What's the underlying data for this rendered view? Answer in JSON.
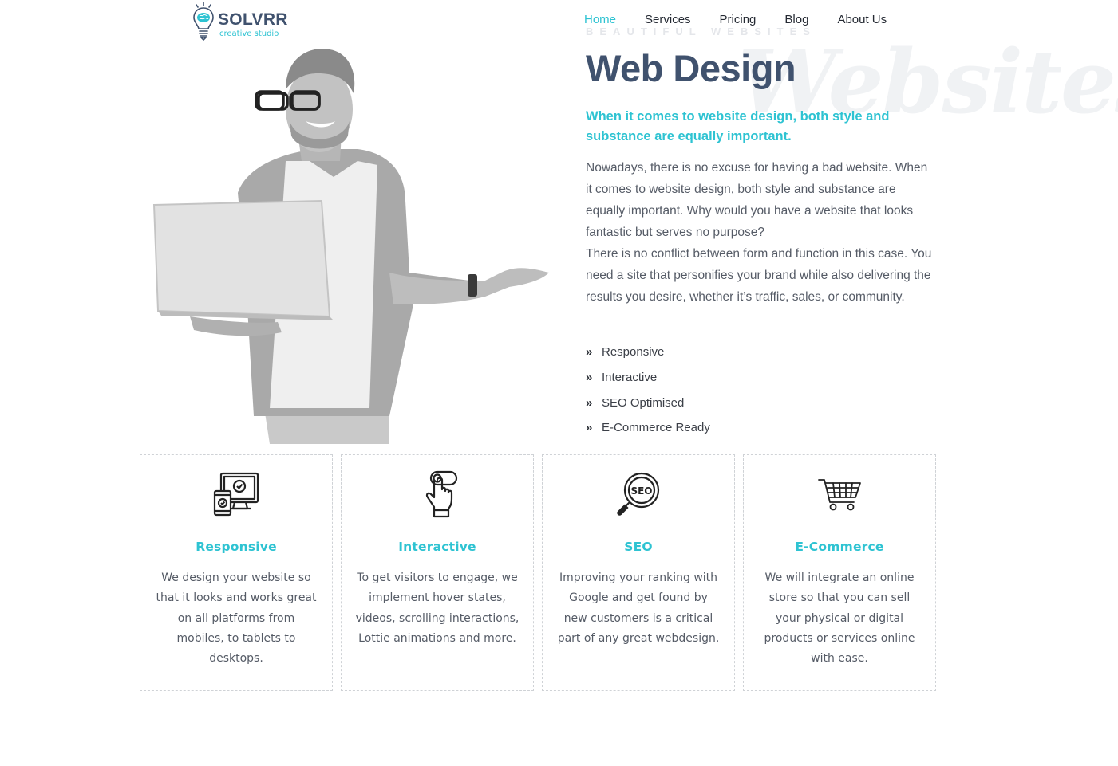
{
  "brand": {
    "name": "SOLVRR",
    "tagline": "creative studio"
  },
  "nav": {
    "items": [
      {
        "label": "Home",
        "active": true
      },
      {
        "label": "Services",
        "active": false
      },
      {
        "label": "Pricing",
        "active": false
      },
      {
        "label": "Blog",
        "active": false
      },
      {
        "label": "About Us",
        "active": false
      }
    ]
  },
  "hero": {
    "overline": "BEAUTIFUL WEBSITES",
    "watermark": "Websites",
    "title": "Web Design",
    "lead": "When it comes to website design, both style and substance are equally important.",
    "paragraphs": [
      "Nowadays, there is no excuse for having a bad website. When it comes to website design, both style and substance are equally important. Why would you have a website that looks fantastic but serves no purpose?",
      "There is no conflict between form and function in this case. You need a site that personifies your brand while also delivering the results you desire, whether it’s traffic, sales, or community."
    ],
    "features": [
      "Responsive",
      "Interactive",
      "SEO Optimised",
      "E-Commerce Ready"
    ],
    "feature_icon": "double-chevron-right-icon"
  },
  "cards": [
    {
      "icon": "devices-icon",
      "title": "Responsive",
      "text": "We design your website so that it looks and works great on all platforms from mobiles, to tablets to desktops."
    },
    {
      "icon": "touch-hand-icon",
      "title": "Interactive",
      "text": "To get visitors to engage, we implement hover states, videos, scrolling interactions, Lottie animations and more."
    },
    {
      "icon": "seo-magnifier-icon",
      "title": "SEO",
      "text": "Improving your ranking with Google and get found by new customers is a critical part of any great webdesign."
    },
    {
      "icon": "shopping-cart-icon",
      "title": "E-Commerce",
      "text": "We will integrate an online store so that you can sell your physical or digital products or services online with ease."
    }
  ],
  "colors": {
    "accent": "#2ec3d2",
    "heading": "#40526e",
    "text": "#555b66"
  }
}
